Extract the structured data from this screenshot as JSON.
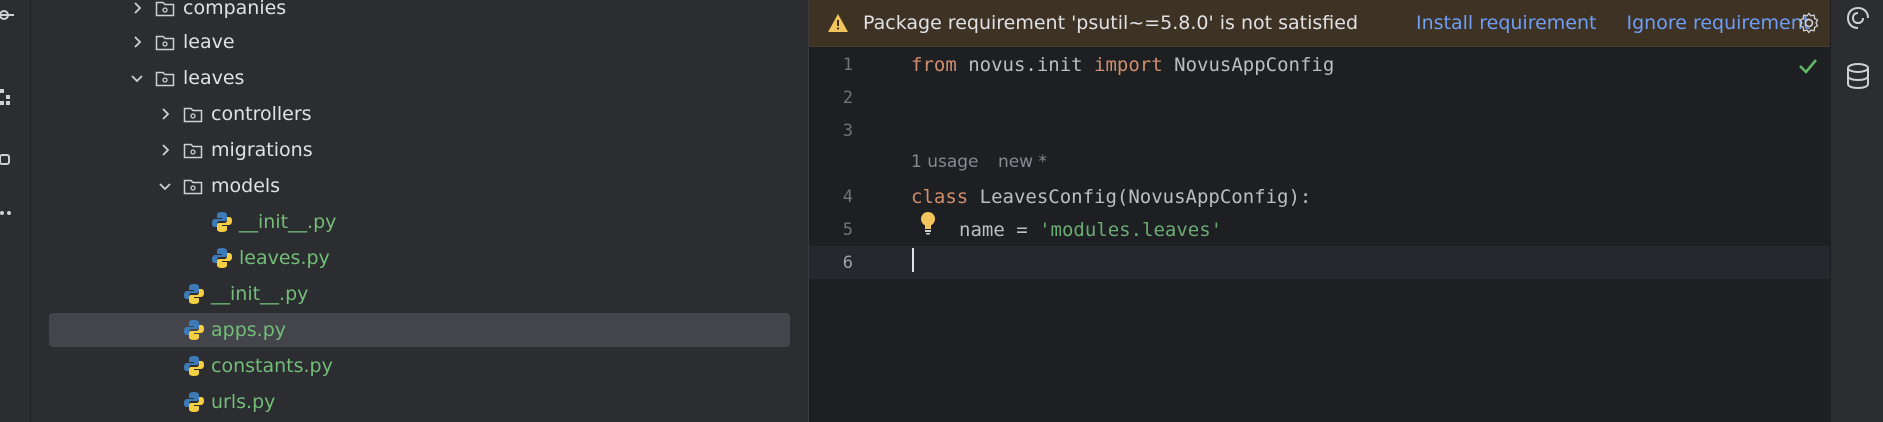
{
  "project_tree": {
    "items": [
      {
        "label": "companies",
        "type": "folder",
        "expanded": false
      },
      {
        "label": "leave",
        "type": "folder",
        "expanded": false
      },
      {
        "label": "leaves",
        "type": "folder",
        "expanded": true
      },
      {
        "label": "controllers",
        "type": "folder",
        "expanded": false
      },
      {
        "label": "migrations",
        "type": "folder",
        "expanded": false
      },
      {
        "label": "models",
        "type": "folder",
        "expanded": true
      },
      {
        "label": "__init__.py",
        "type": "python"
      },
      {
        "label": "leaves.py",
        "type": "python"
      },
      {
        "label": "__init__.py",
        "type": "python"
      },
      {
        "label": "apps.py",
        "type": "python",
        "selected": true
      },
      {
        "label": "constants.py",
        "type": "python"
      },
      {
        "label": "urls.py",
        "type": "python"
      }
    ]
  },
  "banner": {
    "message": "Package requirement 'psutil~=5.8.0' is not satisfied",
    "install_label": "Install requirement",
    "ignore_label": "Ignore requirement"
  },
  "editor": {
    "line_numbers": [
      "1",
      "2",
      "3",
      "4",
      "5",
      "6"
    ],
    "code": {
      "line1_kw1": "from",
      "line1_mid": " novus.init ",
      "line1_kw2": "import",
      "line1_end": " NovusAppConfig",
      "line4_kw": "class",
      "line4_rest": " LeavesConfig(NovusAppConfig):",
      "line5_name": "name = ",
      "line5_str": "'modules.leaves'"
    },
    "inlay_hint": {
      "usages": "1 usage",
      "author": "new *"
    }
  },
  "icons": {
    "warning": "warning-icon",
    "gear": "gear-icon",
    "check": "check-icon",
    "bulb": "lightbulb-icon",
    "ai": "ai-assistant-icon",
    "database": "database-icon"
  },
  "colors": {
    "tree_bg": "#2b2d30",
    "editor_bg": "#1e1f22",
    "banner_bg": "#3d3223",
    "link": "#6f9ef7",
    "python_file_green": "#73bd79",
    "keyword": "#cf8e6d",
    "string": "#6aab73"
  }
}
